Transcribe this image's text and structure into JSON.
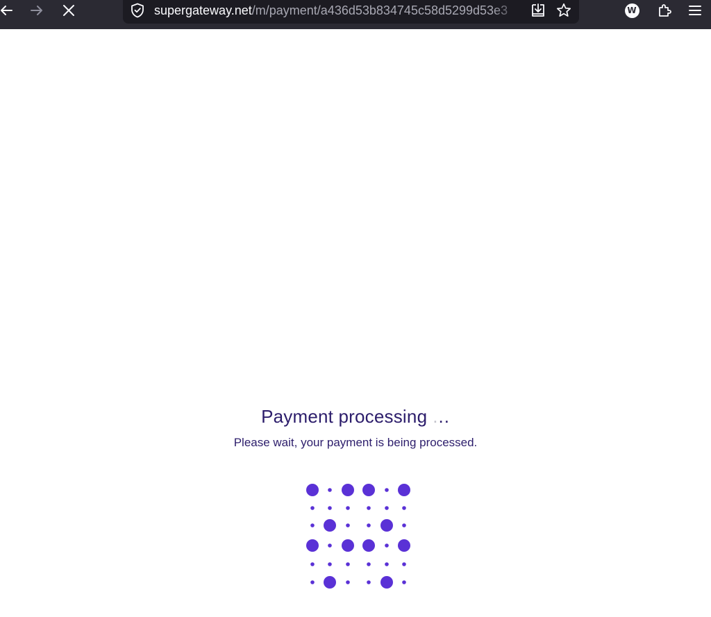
{
  "browser": {
    "url_host": "supergateway.net",
    "url_path": "/m/payment/a436d53b834745c58d5299d53e3",
    "extension_badge": "W"
  },
  "page": {
    "title": "Payment processing",
    "dots": ".",
    "dots_dark": "..",
    "subtitle": "Please wait, your payment is being processed."
  },
  "colors": {
    "toolbar_bg": "#2b2a33",
    "urlbar_bg": "#1c1b22",
    "text_primary": "#2c1d6b",
    "loader_dot": "#5a31d6"
  }
}
